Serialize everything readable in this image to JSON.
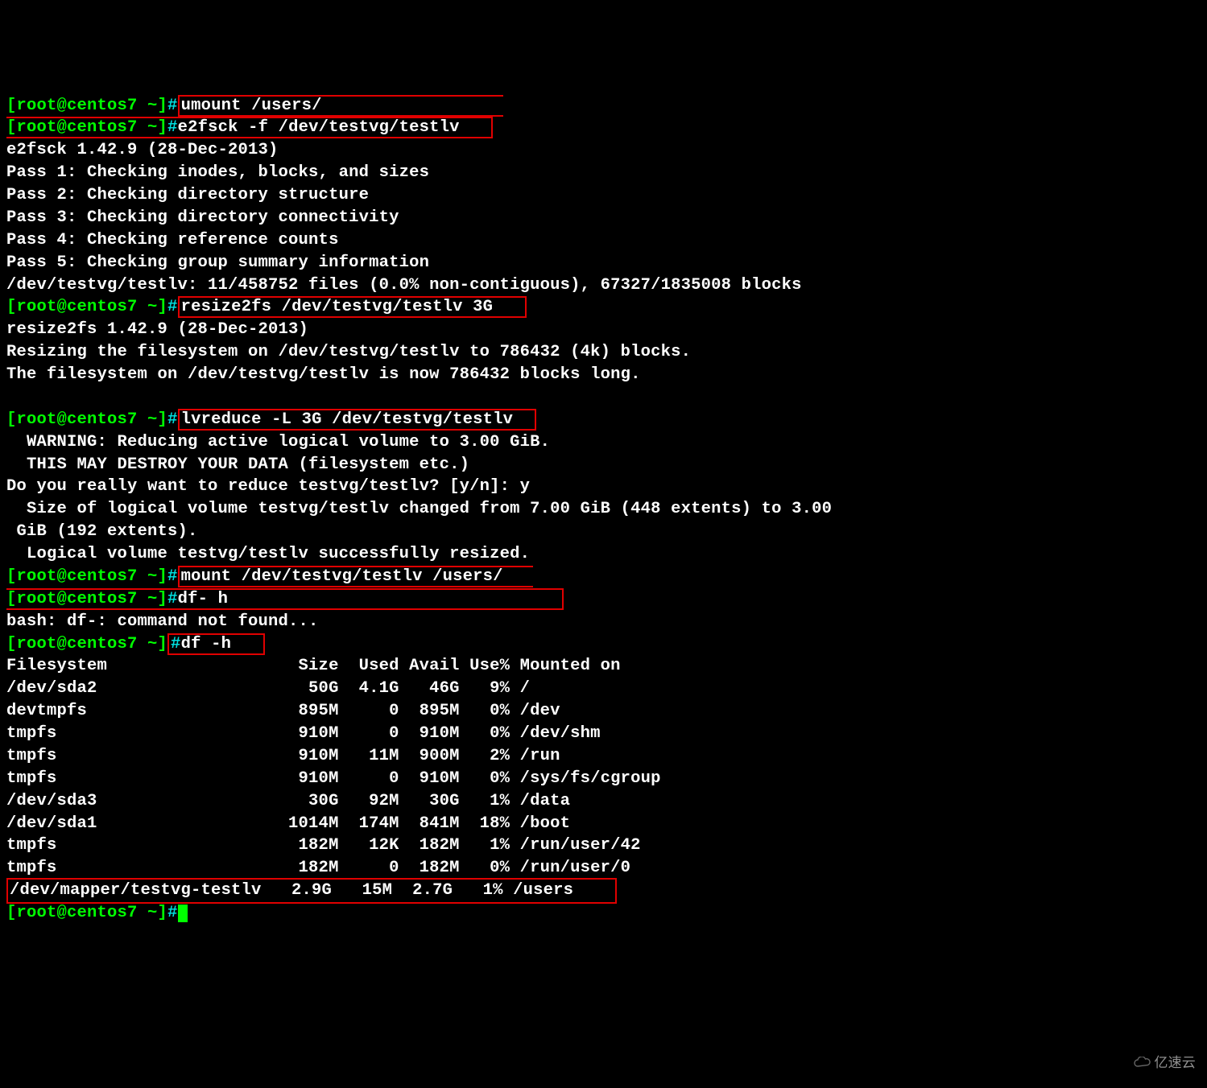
{
  "prompt": {
    "userhost": "[root@centos7 ~]",
    "hash": "#"
  },
  "cmd": {
    "umount": "umount /users/",
    "e2fsck": "e2fsck -f /dev/testvg/testlv",
    "resize2fs": "resize2fs /dev/testvg/testlv 3G",
    "lvreduce": "lvreduce -L 3G /dev/testvg/testlv",
    "mount": "mount /dev/testvg/testlv /users/",
    "df_bad": "df- h",
    "df": "df -h"
  },
  "out": {
    "e2fsck_ver": "e2fsck 1.42.9 (28-Dec-2013)",
    "pass1": "Pass 1: Checking inodes, blocks, and sizes",
    "pass2": "Pass 2: Checking directory structure",
    "pass3": "Pass 3: Checking directory connectivity",
    "pass4": "Pass 4: Checking reference counts",
    "pass5": "Pass 5: Checking group summary information",
    "e2fsck_res": "/dev/testvg/testlv: 11/458752 files (0.0% non-contiguous), 67327/1835008 blocks",
    "resize_ver": "resize2fs 1.42.9 (28-Dec-2013)",
    "resize_l1": "Resizing the filesystem on /dev/testvg/testlv to 786432 (4k) blocks.",
    "resize_l2": "The filesystem on /dev/testvg/testlv is now 786432 blocks long.",
    "lv_warn1": "  WARNING: Reducing active logical volume to 3.00 GiB.",
    "lv_warn2": "  THIS MAY DESTROY YOUR DATA (filesystem etc.)",
    "lv_prompt": "Do you really want to reduce testvg/testlv? [y/n]: y",
    "lv_size1": "  Size of logical volume testvg/testlv changed from 7.00 GiB (448 extents) to 3.00",
    "lv_size2": " GiB (192 extents).",
    "lv_done": "  Logical volume testvg/testlv successfully resized.",
    "bash_err": "bash: df-: command not found..."
  },
  "df": {
    "header": "Filesystem                   Size  Used Avail Use% Mounted on",
    "rows": [
      "/dev/sda2                     50G  4.1G   46G   9% /",
      "devtmpfs                     895M     0  895M   0% /dev",
      "tmpfs                        910M     0  910M   0% /dev/shm",
      "tmpfs                        910M   11M  900M   2% /run",
      "tmpfs                        910M     0  910M   0% /sys/fs/cgroup",
      "/dev/sda3                     30G   92M   30G   1% /data",
      "/dev/sda1                   1014M  174M  841M  18% /boot",
      "tmpfs                        182M   12K  182M   1% /run/user/42",
      "tmpfs                        182M     0  182M   0% /run/user/0"
    ],
    "last": "/dev/mapper/testvg-testlv   2.9G   15M  2.7G   1% /users"
  },
  "watermark": "亿速云"
}
